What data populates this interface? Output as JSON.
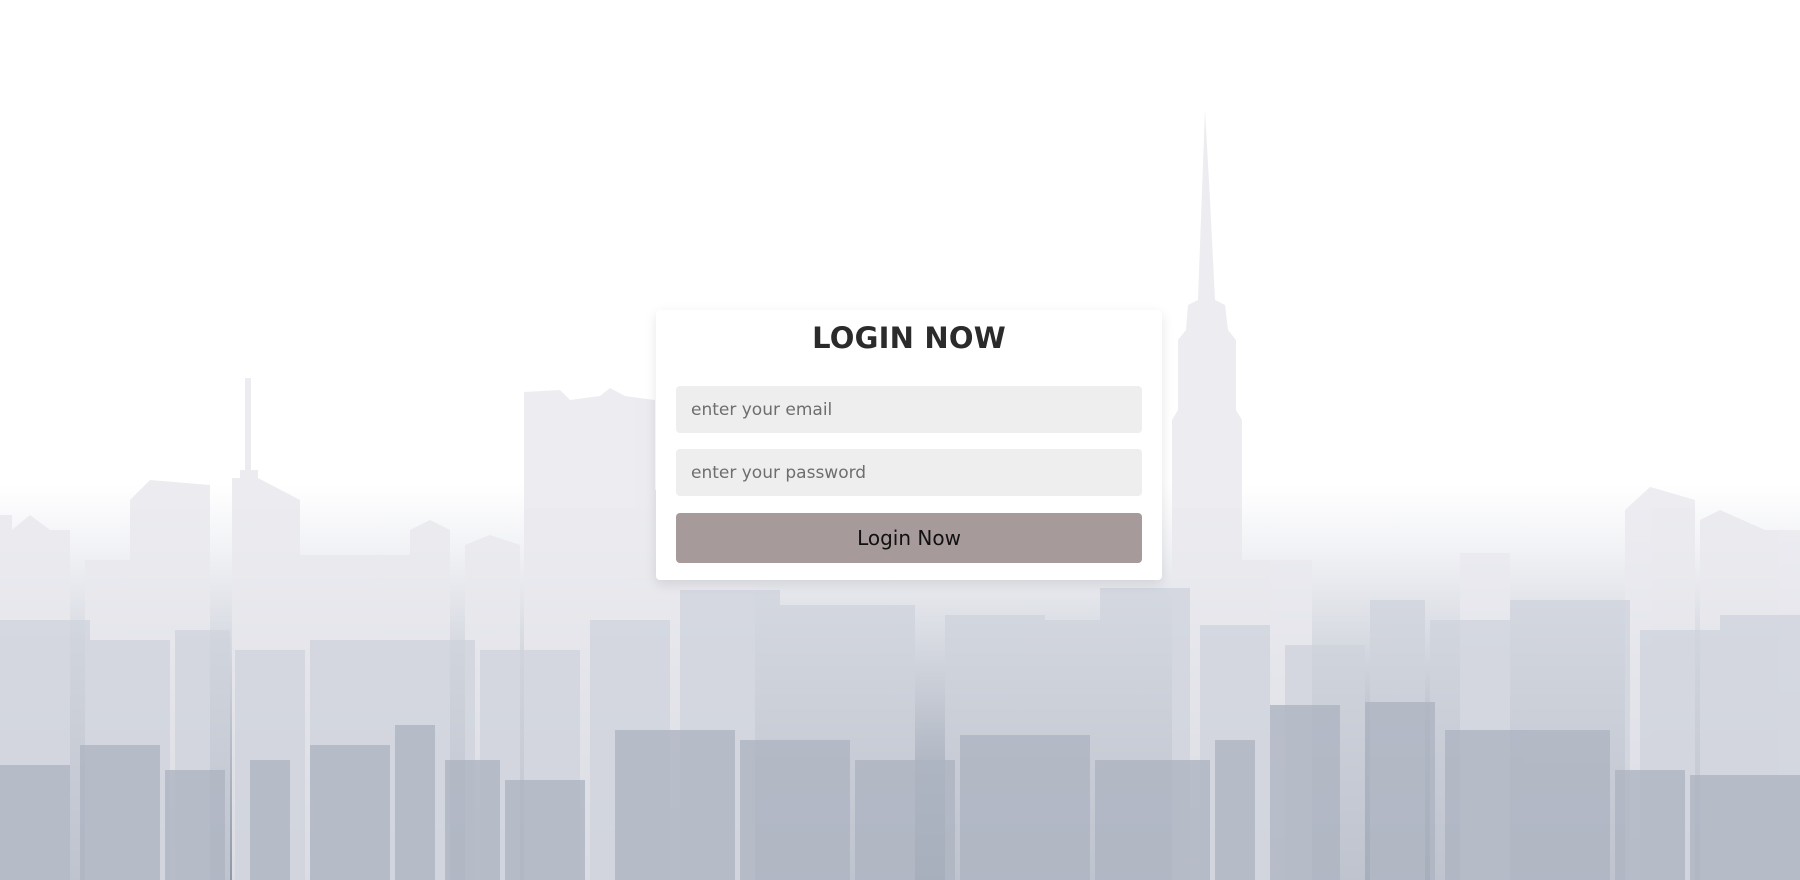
{
  "login": {
    "title": "LOGIN NOW",
    "email_placeholder": "enter your email",
    "password_placeholder": "enter your password",
    "submit_label": "Login Now"
  }
}
